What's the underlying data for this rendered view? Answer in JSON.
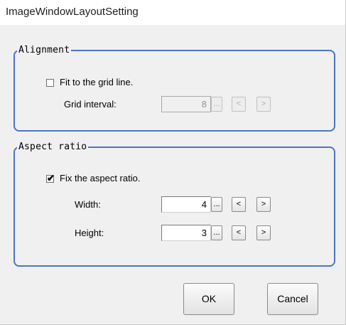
{
  "window": {
    "title": "ImageWindowLayoutSetting"
  },
  "alignment": {
    "group_label": "Alignment",
    "fit_grid_label": "Fit to the grid line.",
    "fit_grid_checked": false,
    "grid_interval_label": "Grid interval:",
    "grid_interval_value": "8",
    "ellipsis": "...",
    "dec": "<",
    "inc": ">"
  },
  "aspect": {
    "group_label": "Aspect ratio",
    "fix_label": "Fix the aspect ratio.",
    "fix_checked": true,
    "check_glyph": "✔",
    "width_label": "Width:",
    "width_value": "4",
    "height_label": "Height:",
    "height_value": "3",
    "ellipsis": "...",
    "dec": "<",
    "inc": ">"
  },
  "buttons": {
    "ok": "OK",
    "cancel": "Cancel"
  }
}
